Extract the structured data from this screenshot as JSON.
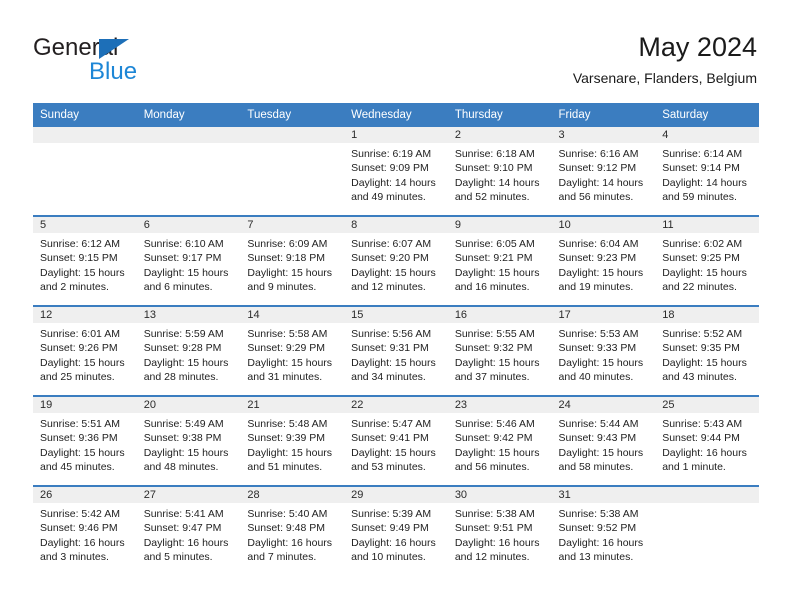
{
  "brand": {
    "name_top": "General",
    "name_bottom": "Blue",
    "color_dark": "#231f20",
    "color_blue": "#1d86d6",
    "triangle_color": "#1d6fb8"
  },
  "header": {
    "title": "May 2024",
    "subtitle": "Varsenare, Flanders, Belgium"
  },
  "theme": {
    "header_bg": "#3b7dc0",
    "header_text": "#ffffff",
    "daynum_band_bg": "#efefef",
    "row_separator": "#3b7dc0"
  },
  "weekdays": [
    "Sunday",
    "Monday",
    "Tuesday",
    "Wednesday",
    "Thursday",
    "Friday",
    "Saturday"
  ],
  "weeks": [
    [
      {
        "empty": true
      },
      {
        "empty": true
      },
      {
        "empty": true
      },
      {
        "day": "1",
        "sunrise": "Sunrise: 6:19 AM",
        "sunset": "Sunset: 9:09 PM",
        "daylight1": "Daylight: 14 hours",
        "daylight2": "and 49 minutes."
      },
      {
        "day": "2",
        "sunrise": "Sunrise: 6:18 AM",
        "sunset": "Sunset: 9:10 PM",
        "daylight1": "Daylight: 14 hours",
        "daylight2": "and 52 minutes."
      },
      {
        "day": "3",
        "sunrise": "Sunrise: 6:16 AM",
        "sunset": "Sunset: 9:12 PM",
        "daylight1": "Daylight: 14 hours",
        "daylight2": "and 56 minutes."
      },
      {
        "day": "4",
        "sunrise": "Sunrise: 6:14 AM",
        "sunset": "Sunset: 9:14 PM",
        "daylight1": "Daylight: 14 hours",
        "daylight2": "and 59 minutes."
      }
    ],
    [
      {
        "day": "5",
        "sunrise": "Sunrise: 6:12 AM",
        "sunset": "Sunset: 9:15 PM",
        "daylight1": "Daylight: 15 hours",
        "daylight2": "and 2 minutes."
      },
      {
        "day": "6",
        "sunrise": "Sunrise: 6:10 AM",
        "sunset": "Sunset: 9:17 PM",
        "daylight1": "Daylight: 15 hours",
        "daylight2": "and 6 minutes."
      },
      {
        "day": "7",
        "sunrise": "Sunrise: 6:09 AM",
        "sunset": "Sunset: 9:18 PM",
        "daylight1": "Daylight: 15 hours",
        "daylight2": "and 9 minutes."
      },
      {
        "day": "8",
        "sunrise": "Sunrise: 6:07 AM",
        "sunset": "Sunset: 9:20 PM",
        "daylight1": "Daylight: 15 hours",
        "daylight2": "and 12 minutes."
      },
      {
        "day": "9",
        "sunrise": "Sunrise: 6:05 AM",
        "sunset": "Sunset: 9:21 PM",
        "daylight1": "Daylight: 15 hours",
        "daylight2": "and 16 minutes."
      },
      {
        "day": "10",
        "sunrise": "Sunrise: 6:04 AM",
        "sunset": "Sunset: 9:23 PM",
        "daylight1": "Daylight: 15 hours",
        "daylight2": "and 19 minutes."
      },
      {
        "day": "11",
        "sunrise": "Sunrise: 6:02 AM",
        "sunset": "Sunset: 9:25 PM",
        "daylight1": "Daylight: 15 hours",
        "daylight2": "and 22 minutes."
      }
    ],
    [
      {
        "day": "12",
        "sunrise": "Sunrise: 6:01 AM",
        "sunset": "Sunset: 9:26 PM",
        "daylight1": "Daylight: 15 hours",
        "daylight2": "and 25 minutes."
      },
      {
        "day": "13",
        "sunrise": "Sunrise: 5:59 AM",
        "sunset": "Sunset: 9:28 PM",
        "daylight1": "Daylight: 15 hours",
        "daylight2": "and 28 minutes."
      },
      {
        "day": "14",
        "sunrise": "Sunrise: 5:58 AM",
        "sunset": "Sunset: 9:29 PM",
        "daylight1": "Daylight: 15 hours",
        "daylight2": "and 31 minutes."
      },
      {
        "day": "15",
        "sunrise": "Sunrise: 5:56 AM",
        "sunset": "Sunset: 9:31 PM",
        "daylight1": "Daylight: 15 hours",
        "daylight2": "and 34 minutes."
      },
      {
        "day": "16",
        "sunrise": "Sunrise: 5:55 AM",
        "sunset": "Sunset: 9:32 PM",
        "daylight1": "Daylight: 15 hours",
        "daylight2": "and 37 minutes."
      },
      {
        "day": "17",
        "sunrise": "Sunrise: 5:53 AM",
        "sunset": "Sunset: 9:33 PM",
        "daylight1": "Daylight: 15 hours",
        "daylight2": "and 40 minutes."
      },
      {
        "day": "18",
        "sunrise": "Sunrise: 5:52 AM",
        "sunset": "Sunset: 9:35 PM",
        "daylight1": "Daylight: 15 hours",
        "daylight2": "and 43 minutes."
      }
    ],
    [
      {
        "day": "19",
        "sunrise": "Sunrise: 5:51 AM",
        "sunset": "Sunset: 9:36 PM",
        "daylight1": "Daylight: 15 hours",
        "daylight2": "and 45 minutes."
      },
      {
        "day": "20",
        "sunrise": "Sunrise: 5:49 AM",
        "sunset": "Sunset: 9:38 PM",
        "daylight1": "Daylight: 15 hours",
        "daylight2": "and 48 minutes."
      },
      {
        "day": "21",
        "sunrise": "Sunrise: 5:48 AM",
        "sunset": "Sunset: 9:39 PM",
        "daylight1": "Daylight: 15 hours",
        "daylight2": "and 51 minutes."
      },
      {
        "day": "22",
        "sunrise": "Sunrise: 5:47 AM",
        "sunset": "Sunset: 9:41 PM",
        "daylight1": "Daylight: 15 hours",
        "daylight2": "and 53 minutes."
      },
      {
        "day": "23",
        "sunrise": "Sunrise: 5:46 AM",
        "sunset": "Sunset: 9:42 PM",
        "daylight1": "Daylight: 15 hours",
        "daylight2": "and 56 minutes."
      },
      {
        "day": "24",
        "sunrise": "Sunrise: 5:44 AM",
        "sunset": "Sunset: 9:43 PM",
        "daylight1": "Daylight: 15 hours",
        "daylight2": "and 58 minutes."
      },
      {
        "day": "25",
        "sunrise": "Sunrise: 5:43 AM",
        "sunset": "Sunset: 9:44 PM",
        "daylight1": "Daylight: 16 hours",
        "daylight2": "and 1 minute."
      }
    ],
    [
      {
        "day": "26",
        "sunrise": "Sunrise: 5:42 AM",
        "sunset": "Sunset: 9:46 PM",
        "daylight1": "Daylight: 16 hours",
        "daylight2": "and 3 minutes."
      },
      {
        "day": "27",
        "sunrise": "Sunrise: 5:41 AM",
        "sunset": "Sunset: 9:47 PM",
        "daylight1": "Daylight: 16 hours",
        "daylight2": "and 5 minutes."
      },
      {
        "day": "28",
        "sunrise": "Sunrise: 5:40 AM",
        "sunset": "Sunset: 9:48 PM",
        "daylight1": "Daylight: 16 hours",
        "daylight2": "and 7 minutes."
      },
      {
        "day": "29",
        "sunrise": "Sunrise: 5:39 AM",
        "sunset": "Sunset: 9:49 PM",
        "daylight1": "Daylight: 16 hours",
        "daylight2": "and 10 minutes."
      },
      {
        "day": "30",
        "sunrise": "Sunrise: 5:38 AM",
        "sunset": "Sunset: 9:51 PM",
        "daylight1": "Daylight: 16 hours",
        "daylight2": "and 12 minutes."
      },
      {
        "day": "31",
        "sunrise": "Sunrise: 5:38 AM",
        "sunset": "Sunset: 9:52 PM",
        "daylight1": "Daylight: 16 hours",
        "daylight2": "and 13 minutes."
      },
      {
        "empty": true
      }
    ]
  ]
}
